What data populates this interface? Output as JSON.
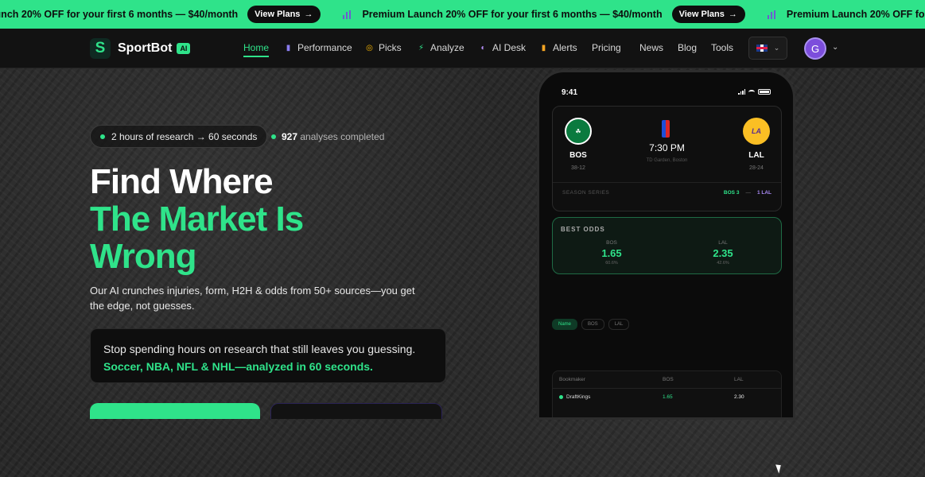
{
  "promo": {
    "items": [
      {
        "text": "Premium Launch 20% OFF for your first 6 months — $40/month",
        "button": "View Plans"
      },
      {
        "text": "Premium Launch 20% OFF for your first 6 months — $40/month",
        "button": "View Plans"
      },
      {
        "text": "Premium Launch 20% OFF for your first 6 months — $40/month",
        "button": "View Plans"
      }
    ],
    "accent": "#2fe38a"
  },
  "header": {
    "logo_text": "SportBot",
    "logo_badge": "AI",
    "nav": [
      {
        "label": "Home",
        "icon": "",
        "active": true
      },
      {
        "label": "Performance",
        "icon": "bar-chart-icon"
      },
      {
        "label": "Picks",
        "icon": "target-icon"
      },
      {
        "label": "Analyze",
        "icon": "bolt-icon"
      },
      {
        "label": "AI Desk",
        "icon": "globe-icon"
      },
      {
        "label": "Alerts",
        "icon": "bar-chart-icon"
      },
      {
        "label": "Pricing",
        "icon": ""
      },
      {
        "label": "News",
        "icon": ""
      },
      {
        "label": "Blog",
        "icon": ""
      },
      {
        "label": "Tools",
        "icon": ""
      }
    ],
    "avatar_initial": "G",
    "language_flag": "uk-flag-icon"
  },
  "hero": {
    "pill": "2 hours of research → 60 seconds",
    "analyses_count": "927",
    "analyses_label": "analyses completed",
    "headline_line1": "Find Where",
    "headline_line2": "The Market Is",
    "headline_line3": "Wrong",
    "subtitle": "Our AI crunches injuries, form, H2H & odds from 50+ sources—you get the edge, not guesses.",
    "callout_text": "Stop spending hours on research that still leaves you guessing.",
    "callout_highlight": "Soccer, NBA, NFL & NHL—analyzed in 60 seconds."
  },
  "phone": {
    "time": "9:41",
    "home": {
      "abbr": "BOS",
      "record": "38-12",
      "logo_text": "CELTICS"
    },
    "away": {
      "abbr": "LAL",
      "record": "28-24",
      "logo_text": "LAKERS"
    },
    "game_time": "7:30 PM",
    "venue": "TD Garden, Boston",
    "series_label": "SEASON SERIES",
    "series_home": "BOS 3",
    "series_sep": "—",
    "series_away": "1 LAL",
    "best_odds_title": "BEST ODDS",
    "odds": [
      {
        "team": "BOS",
        "value": "1.65",
        "pct": "60.6%"
      },
      {
        "team": "LAL",
        "value": "2.35",
        "pct": "42.6%"
      }
    ],
    "chips": [
      "Name",
      "BOS",
      "LAL"
    ],
    "table_headers": [
      "Bookmaker",
      "BOS",
      "LAL"
    ],
    "rows": [
      {
        "book": "DraftKings",
        "bos": "1.65",
        "lal": "2.30"
      }
    ]
  }
}
